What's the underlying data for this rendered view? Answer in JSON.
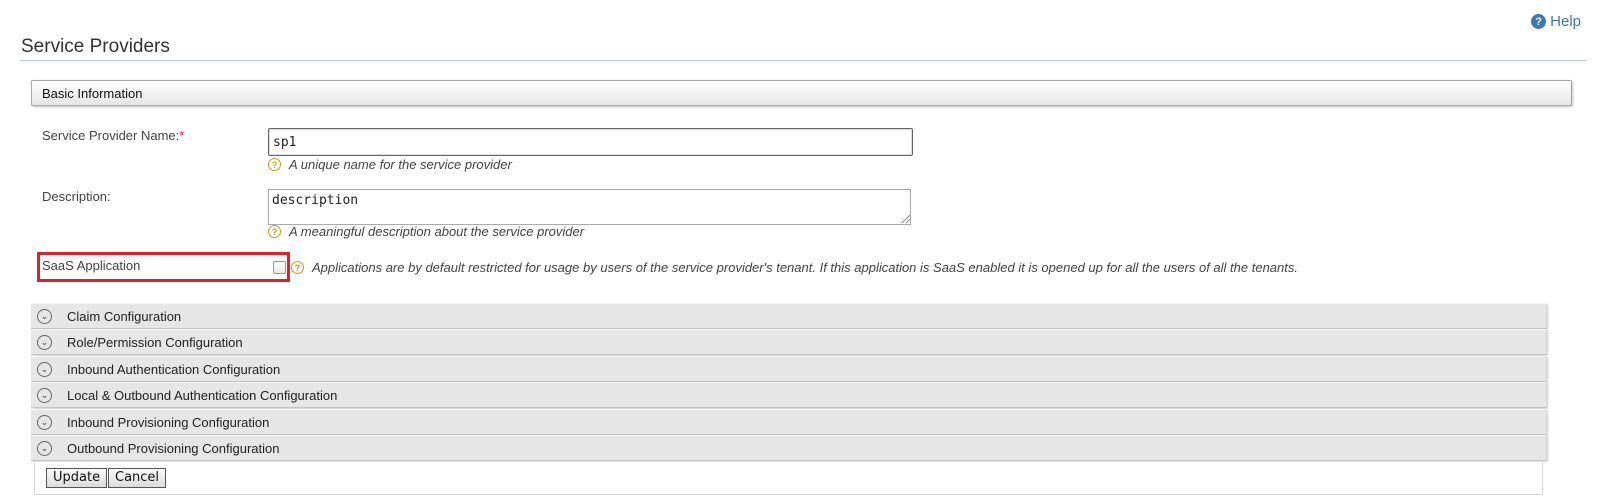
{
  "header": {
    "help_label": "Help",
    "title": "Service Providers"
  },
  "basic_info": {
    "section_title": "Basic Information",
    "name_label": "Service Provider Name:",
    "required_mark": "*",
    "name_value": "sp1",
    "name_hint": "A unique name for the service provider",
    "description_label": "Description:",
    "description_value": "description",
    "description_hint": "A meaningful description about the service provider",
    "saas_label": "SaaS Application",
    "saas_checked": false,
    "saas_hint": "Applications are by default restricted for usage by users of the service provider's tenant. If this application is SaaS enabled it is opened up for all the users of all the tenants."
  },
  "accordions": [
    {
      "label": "Claim Configuration"
    },
    {
      "label": "Role/Permission Configuration"
    },
    {
      "label": "Inbound Authentication Configuration"
    },
    {
      "label": "Local & Outbound Authentication Configuration"
    },
    {
      "label": "Inbound Provisioning Configuration"
    },
    {
      "label": "Outbound Provisioning Configuration"
    }
  ],
  "actions": {
    "update_label": "Update",
    "cancel_label": "Cancel"
  },
  "colors": {
    "accent": "#3b78b9",
    "highlight_border": "#e0202a",
    "required": "#e02020",
    "hint_icon": "#c89b16"
  }
}
